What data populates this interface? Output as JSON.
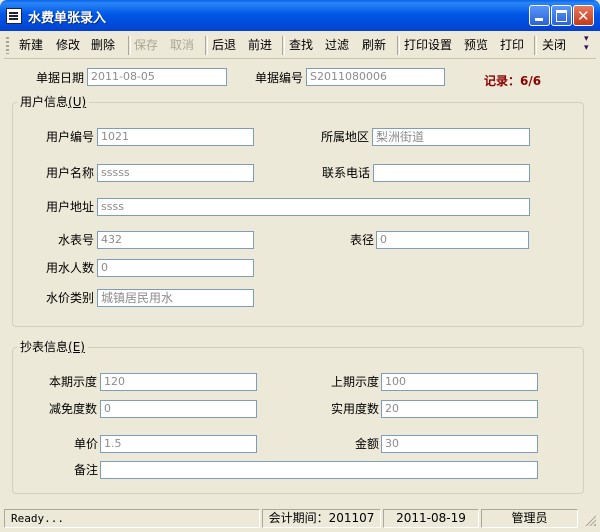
{
  "window": {
    "title": "水费单张录入"
  },
  "toolbar": {
    "new": "新建",
    "edit": "修改",
    "delete": "删除",
    "save": "保存",
    "cancel": "取消",
    "back": "后退",
    "forward": "前进",
    "find": "查找",
    "filter": "过滤",
    "refresh": "刷新",
    "print_setup": "打印设置",
    "preview": "预览",
    "print": "打印",
    "close": "关闭"
  },
  "header": {
    "date_label": "单据日期",
    "date_value": "2011-08-05",
    "no_label": "单据编号",
    "no_value": "S2011080006",
    "record_text": "记录：6/6"
  },
  "user_group": {
    "title": "用户信息",
    "hotkey": "(U)",
    "user_no_label": "用户编号",
    "user_no_value": "1021",
    "area_label": "所属地区",
    "area_value": "梨洲街道",
    "user_name_label": "用户名称",
    "user_name_value": "sssss",
    "phone_label": "联系电话",
    "phone_value": "",
    "address_label": "用户地址",
    "address_value": "ssss",
    "meter_no_label": "水表号",
    "meter_no_value": "432",
    "meter_size_label": "表径",
    "meter_size_value": "0",
    "people_label": "用水人数",
    "people_value": "0",
    "price_type_label": "水价类别",
    "price_type_value": "城镇居民用水"
  },
  "reading_group": {
    "title": "抄表信息",
    "hotkey": "(E)",
    "current_label": "本期示度",
    "current_value": "120",
    "last_label": "上期示度",
    "last_value": "100",
    "reduce_label": "减免度数",
    "reduce_value": "0",
    "actual_label": "实用度数",
    "actual_value": "20",
    "price_label": "单价",
    "price_value": "1.5",
    "amount_label": "金额",
    "amount_value": "30",
    "remark_label": "备注",
    "remark_value": ""
  },
  "status": {
    "ready": "Ready...",
    "period": "会计期间：201107",
    "date": "2011-08-19",
    "user": "管理员"
  },
  "colors": {
    "title_bar": "#0058e6",
    "window_bg": "#ece9d8",
    "record": "#8b0000",
    "field_border": "#7f9db9"
  }
}
